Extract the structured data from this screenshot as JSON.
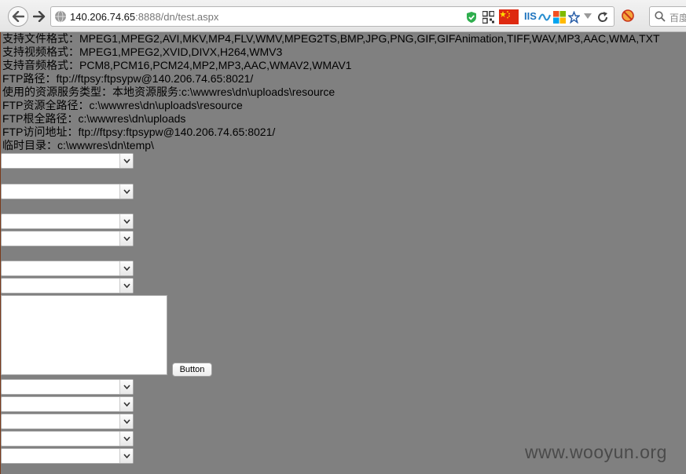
{
  "browser": {
    "url_host": "140.206.74.65",
    "url_rest": ":8888/dn/test.aspx",
    "search_placeholder": "百度",
    "iis_label": "IIS"
  },
  "page": {
    "lines": [
      "支持文件格式：MPEG1,MPEG2,AVI,MKV,MP4,FLV,WMV,MPEG2TS,BMP,JPG,PNG,GIF,GIFAnimation,TIFF,WAV,MP3,AAC,WMA,TXT",
      "支持视频格式：MPEG1,MPEG2,XVID,DIVX,H264,WMV3",
      "支持音频格式：PCM8,PCM16,PCM24,MP2,MP3,AAC,WMAV2,WMAV1",
      "FTP路径：ftp://ftpsy:ftpsypw@140.206.74.65:8021/",
      "使用的资源服务类型：本地资源服务:c:\\wwwres\\dn\\uploads\\resource",
      "FTP资源全路径：c:\\wwwres\\dn\\uploads\\resource",
      "FTP根全路径：c:\\wwwres\\dn\\uploads",
      "FTP访问地址：ftp://ftpsy:ftpsypw@140.206.74.65:8021/",
      "临时目录：c:\\wwwres\\dn\\temp\\"
    ],
    "button_label": "Button",
    "watermark": "www.wooyun.org"
  },
  "colors": {
    "page_background": "#808080",
    "flag_red": "#de2910",
    "flag_yellow": "#ffde00",
    "shield_green": "#2fae4e",
    "iis_blue": "#1e73be"
  },
  "icons": [
    "back-arrow-icon",
    "forward-arrow-icon",
    "globe-icon",
    "shield-icon",
    "qr-code-icon",
    "china-flag-icon",
    "iis-icon",
    "ms-logo-icon",
    "bookmark-icon",
    "dropdown-arrow-icon",
    "reload-icon",
    "no-script-icon",
    "search-icon",
    "select-chevron-icon"
  ]
}
